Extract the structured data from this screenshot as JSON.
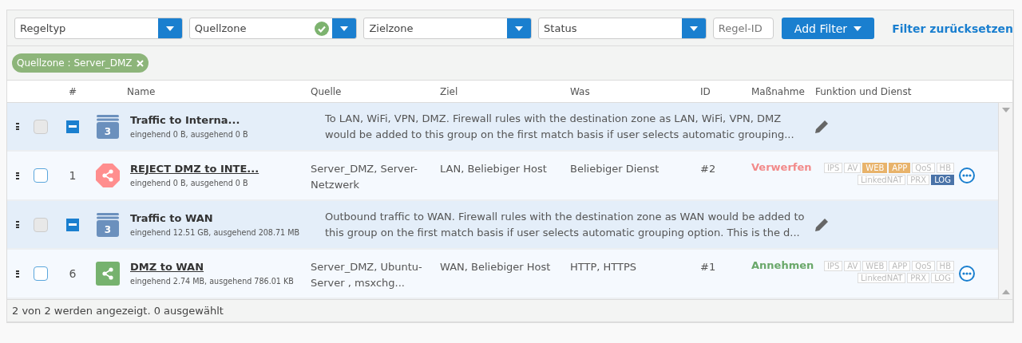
{
  "filters": [
    {
      "label": "Regeltyp",
      "active": false
    },
    {
      "label": "Quellzone",
      "active": true
    },
    {
      "label": "Zielzone",
      "active": false
    },
    {
      "label": "Status",
      "active": false
    }
  ],
  "rule_id": {
    "placeholder": "Regel-ID"
  },
  "add_filter": "Add Filter",
  "reset": "Filter zurücksetzen",
  "chips": [
    {
      "label": "Quellzone : Server_DMZ"
    }
  ],
  "columns": [
    "#",
    "Name",
    "Quelle",
    "Ziel",
    "Was",
    "ID",
    "Maßnahme",
    "Funktion und Dienst"
  ],
  "rows": [
    {
      "kind": "group",
      "checked": false,
      "expanded": true,
      "count": "3",
      "name": "Traffic to Interna...",
      "traffic": "eingehend 0 B, ausgehend 0 B",
      "description": "To LAN, WiFi, VPN, DMZ. Firewall rules with the destination zone as LAN, WiFi, VPN, DMZ would be added to this group on the first match basis if user selects automatic grouping..."
    },
    {
      "kind": "reject",
      "checked": false,
      "number": "1",
      "name": "REJECT DMZ to INTE...",
      "traffic": "eingehend 0 B, ausgehend 0 B",
      "source": "Server_DMZ, Server-Netzwerk",
      "destination": "LAN, Beliebiger Host",
      "service": "Beliebiger Dienst",
      "id": "#2",
      "action": "Verwerfen",
      "features": [
        {
          "tags": [
            {
              "label": "IPS",
              "on": false
            },
            {
              "label": "AV",
              "on": false
            },
            {
              "label": "WEB",
              "on": true,
              "color": "#e8b36b"
            },
            {
              "label": "APP",
              "on": true,
              "color": "#e8b36b"
            },
            {
              "label": "QoS",
              "on": false
            },
            {
              "label": "HB",
              "on": false
            }
          ]
        },
        {
          "tags": [
            {
              "label": "LinkedNAT",
              "on": false
            },
            {
              "label": "PRX",
              "on": false
            },
            {
              "label": "LOG",
              "on": true,
              "color": "#4a73a8"
            }
          ]
        }
      ]
    },
    {
      "kind": "group",
      "checked": false,
      "expanded": true,
      "count": "3",
      "name": "Traffic to WAN",
      "traffic": "eingehend 12.51 GB, ausgehend 208.71 MB",
      "description": "Outbound traffic to WAN. Firewall rules with the destination zone as WAN would be added to this group on the first match basis if user selects automatic grouping option. This is the d..."
    },
    {
      "kind": "accept",
      "checked": false,
      "number": "6",
      "name": "DMZ to WAN",
      "traffic": "eingehend 2.74 MB, ausgehend 786.01 KB",
      "source": "Server_DMZ, Ubuntu-Server , msxchg...",
      "destination": "WAN, Beliebiger Host",
      "service": "HTTP, HTTPS",
      "id": "#1",
      "action": "Annehmen",
      "features": [
        {
          "tags": [
            {
              "label": "IPS",
              "on": false
            },
            {
              "label": "AV",
              "on": false
            },
            {
              "label": "WEB",
              "on": false
            },
            {
              "label": "APP",
              "on": false
            },
            {
              "label": "QoS",
              "on": false
            },
            {
              "label": "HB",
              "on": false
            }
          ]
        },
        {
          "tags": [
            {
              "label": "LinkedNAT",
              "on": false
            },
            {
              "label": "PRX",
              "on": false
            },
            {
              "label": "LOG",
              "on": false
            }
          ]
        }
      ]
    }
  ],
  "footer": "2 von 2 werden angezeigt. 0 ausgewählt"
}
